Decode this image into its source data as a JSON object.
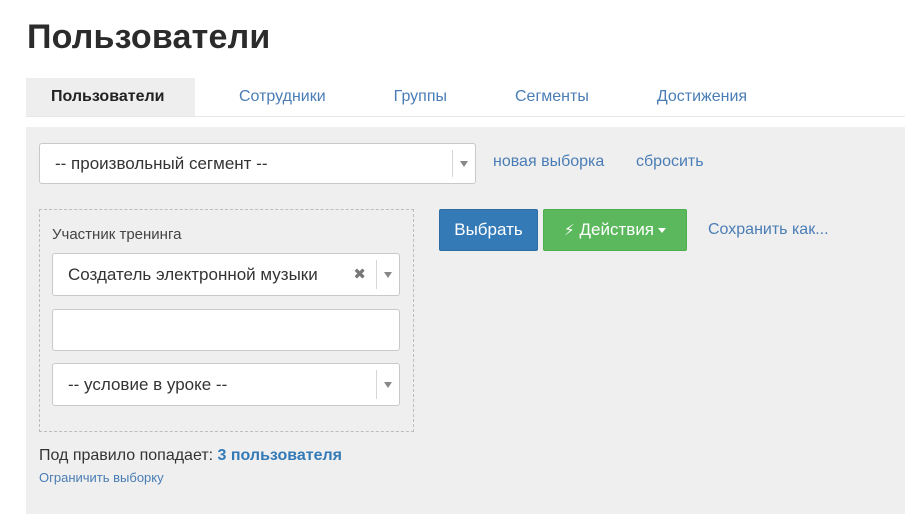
{
  "header": {
    "title": "Пользователи"
  },
  "tabs": [
    {
      "label": "Пользователи"
    },
    {
      "label": "Сотрудники"
    },
    {
      "label": "Группы"
    },
    {
      "label": "Сегменты"
    },
    {
      "label": "Достижения"
    }
  ],
  "segment": {
    "selected": "-- произвольный сегмент --",
    "new_selection": "новая выборка",
    "reset": "сбросить"
  },
  "rule": {
    "label": "Участник тренинга",
    "training_value": "Создатель электронной музыки",
    "text_value": "",
    "condition_value": "-- условие в уроке --"
  },
  "actions": {
    "select_label": "Выбрать",
    "actions_label": "Действия",
    "save_as_label": "Сохранить как..."
  },
  "result": {
    "prefix": "Под правило попадает:",
    "count_text": "3 пользователя",
    "limit_label": "Ограничить выборку"
  },
  "colors": {
    "primary": "#337ab7",
    "success": "#5cb85c",
    "link": "#4a7db5",
    "panel_bg": "#efefef"
  }
}
